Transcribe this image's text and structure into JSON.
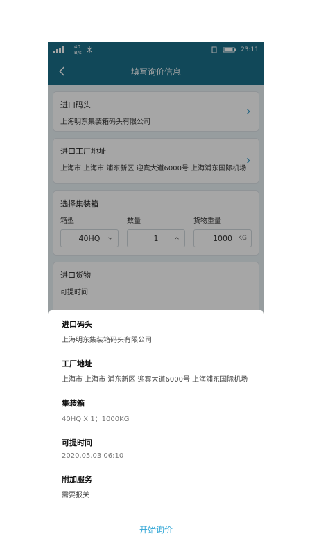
{
  "status": {
    "time": "23:11",
    "network": "40\nB/s"
  },
  "appbar": {
    "title": "填写询价信息"
  },
  "background": {
    "card1": {
      "title": "进口码头",
      "value": "上海明东集装箱码头有限公司"
    },
    "card2": {
      "title": "进口工厂地址",
      "value": "上海市 上海市 浦东新区 迎宾大道6000号 上海浦东国际机场"
    },
    "card3": {
      "title": "选择集装箱",
      "labels": [
        "箱型",
        "数量",
        "货物重量"
      ],
      "values": [
        "40HQ",
        "1",
        "1000"
      ],
      "unit": "KG"
    },
    "card4": {
      "title": "进口货物",
      "sub": "可提时间"
    }
  },
  "sheet": {
    "rows": [
      {
        "label": "进口码头",
        "value": "上海明东集装箱码头有限公司"
      },
      {
        "label": "工厂地址",
        "value": "上海市 上海市 浦东新区 迎宾大道6000号 上海浦东国际机场"
      },
      {
        "label": "集装箱",
        "value": "40HQ X 1；1000KG"
      },
      {
        "label": "可提时间",
        "value": "2020.05.03 06:10"
      },
      {
        "label": "附加服务",
        "value": "需要报关"
      }
    ],
    "cta": "开始询价"
  },
  "colors": {
    "primary": "#1b6f89",
    "accent": "#30a6d6"
  }
}
